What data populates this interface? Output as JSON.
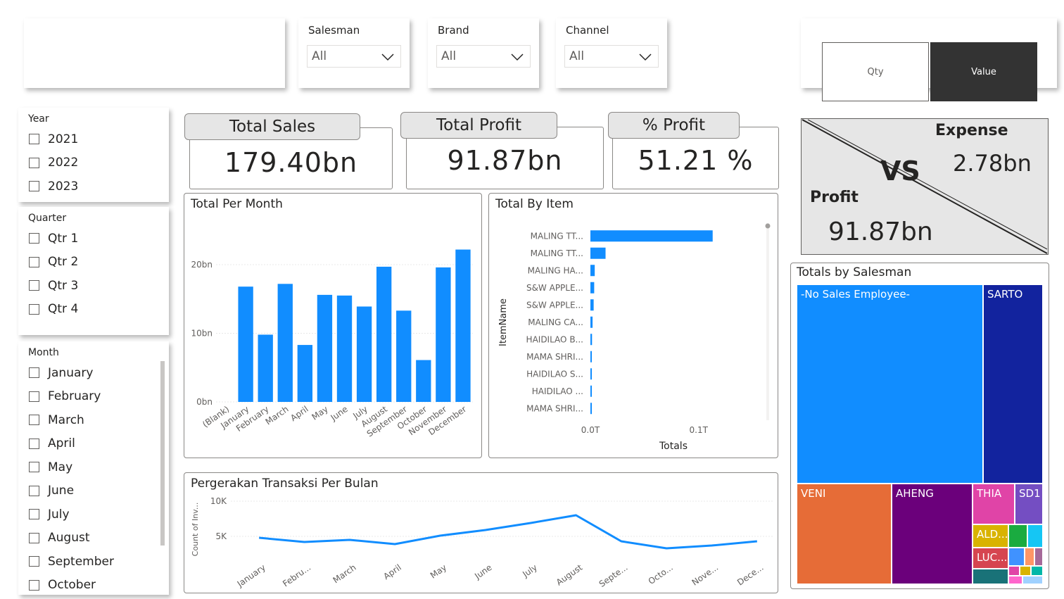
{
  "filters": {
    "salesman": {
      "label": "Salesman",
      "value": "All"
    },
    "brand": {
      "label": "Brand",
      "value": "All"
    },
    "channel": {
      "label": "Channel",
      "value": "All"
    }
  },
  "toggle": {
    "qty_label": "Qty",
    "value_label": "Value",
    "selected": "Value"
  },
  "slicers": {
    "year": {
      "title": "Year",
      "items": [
        "2021",
        "2022",
        "2023"
      ]
    },
    "quarter": {
      "title": "Quarter",
      "items": [
        "Qtr 1",
        "Qtr 2",
        "Qtr 3",
        "Qtr 4"
      ]
    },
    "month": {
      "title": "Month",
      "items": [
        "January",
        "February",
        "March",
        "April",
        "May",
        "June",
        "July",
        "August",
        "September",
        "October"
      ]
    }
  },
  "kpis": {
    "total_sales": {
      "label": "Total Sales",
      "value": "179.40bn"
    },
    "total_profit": {
      "label": "Total Profit",
      "value": "91.87bn"
    },
    "pct_profit": {
      "label": "% Profit",
      "value": "51.21 %"
    }
  },
  "versus": {
    "expense_label": "Expense",
    "expense_value": "2.78bn",
    "vs_label": "VS",
    "profit_label": "Profit",
    "profit_value": "91.87bn"
  },
  "chart_data": [
    {
      "type": "bar",
      "title": "Total Per Month",
      "categories": [
        "(Blank)",
        "January",
        "February",
        "March",
        "April",
        "May",
        "June",
        "July",
        "August",
        "September",
        "October",
        "November",
        "December"
      ],
      "values": [
        0,
        16.8,
        9.8,
        17.2,
        8.3,
        15.6,
        15.5,
        13.9,
        19.7,
        13.3,
        6.1,
        19.6,
        22.2
      ],
      "unit": "bn",
      "yticks": [
        "0bn",
        "10bn",
        "20bn"
      ],
      "ylim": [
        0,
        24
      ],
      "color": "#118dff",
      "grid": true
    },
    {
      "type": "bar",
      "orientation": "horizontal",
      "title": "Total By Item",
      "ylabel": "ItemName",
      "xlabel": "Totals",
      "categories": [
        "MALING TT...",
        "MALING TT...",
        "MALING HA...",
        "S&W APPLE...",
        "S&W APPLE...",
        "MALING CA...",
        "HAIDILAO B...",
        "MAMA SHRI...",
        "HAIDILAO S...",
        "HAIDILAO ...",
        "MAMA SHRI..."
      ],
      "values": [
        0.113,
        0.014,
        0.004,
        0.0035,
        0.003,
        0.002,
        0.0015,
        0.0012,
        0.001,
        0.0008,
        0.0006
      ],
      "xticks": [
        "0.0T",
        "0.1T"
      ],
      "xlim": [
        0,
        0.16
      ],
      "color": "#118dff"
    },
    {
      "type": "line",
      "title": "Pergerakan Transaksi Per Bulan",
      "ylabel": "Count of Inv...",
      "categories": [
        "January",
        "Febru...",
        "March",
        "April",
        "May",
        "June",
        "July",
        "August",
        "Septe...",
        "Octo...",
        "Nove...",
        "Dece..."
      ],
      "values": [
        4800,
        4200,
        4500,
        3900,
        5100,
        5900,
        6900,
        8000,
        4300,
        3300,
        3700,
        4300
      ],
      "yticks": [
        "5K",
        "10K"
      ],
      "ylim": [
        0,
        10000
      ],
      "color": "#118dff"
    },
    {
      "type": "treemap",
      "title": "Totals by Salesman",
      "items": [
        {
          "name": "-No Sales Employee-",
          "color": "#118dff"
        },
        {
          "name": "SARTO",
          "color": "#12239e"
        },
        {
          "name": "VENI",
          "color": "#e66c37"
        },
        {
          "name": "AHENG",
          "color": "#6b007b"
        },
        {
          "name": "THIA",
          "color": "#e044a7"
        },
        {
          "name": "SD1",
          "color": "#744ec2"
        },
        {
          "name": "ALD...",
          "color": "#d9b300"
        },
        {
          "name": "LUC...",
          "color": "#d64550"
        }
      ]
    }
  ]
}
